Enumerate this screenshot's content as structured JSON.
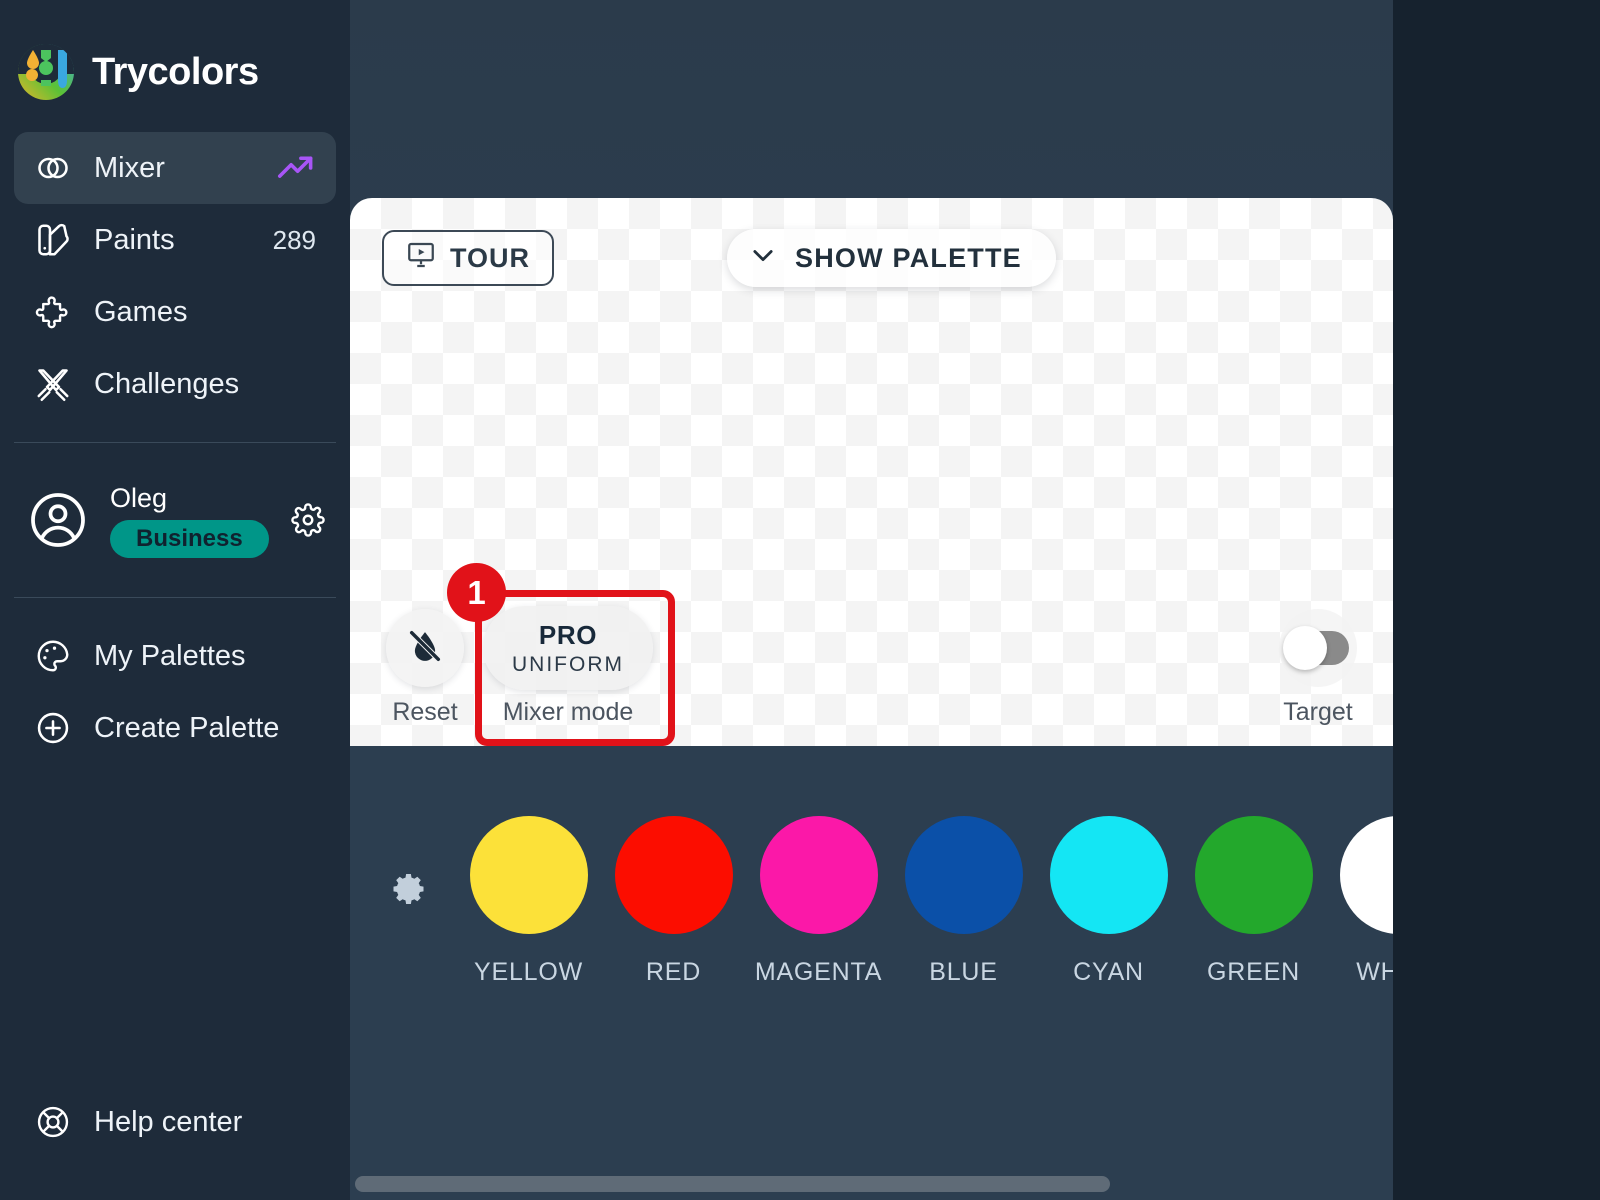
{
  "app": {
    "brand_name": "Trycolors",
    "logo_icon": "trycolors-logo-icon"
  },
  "theme": {
    "sidebar_bg": "#1e2b3a",
    "main_bg": "#2c3e50",
    "outer_bg": "#16222e",
    "accent_teal": "#009688",
    "accent_purple": "#a855f7",
    "annotation_red": "#e11219"
  },
  "sidebar": {
    "items": [
      {
        "label": "Mixer",
        "icon": "mixer-circles-icon",
        "active": true,
        "trend_icon": "trending-up-icon",
        "badge": ""
      },
      {
        "label": "Paints",
        "icon": "paint-swatch-icon",
        "active": false,
        "badge": "289"
      },
      {
        "label": "Games",
        "icon": "puzzle-piece-icon",
        "active": false,
        "badge": ""
      },
      {
        "label": "Challenges",
        "icon": "crossed-swords-icon",
        "active": false,
        "badge": ""
      }
    ],
    "user": {
      "name": "Oleg",
      "plan": "Business",
      "avatar_icon": "user-circle-icon",
      "settings_icon": "gear-icon"
    },
    "palette_items": [
      {
        "label": "My Palettes",
        "icon": "palette-icon"
      },
      {
        "label": "Create Palette",
        "icon": "plus-circle-icon"
      }
    ],
    "help": {
      "label": "Help center",
      "icon": "lifebuoy-icon"
    }
  },
  "canvas": {
    "tour_button": {
      "label": "TOUR",
      "icon": "presentation-play-icon"
    },
    "show_palette_button": {
      "label": "SHOW PALETTE",
      "icon": "chevron-down-icon"
    },
    "controls": {
      "reset": {
        "label": "Reset",
        "icon": "droplet-slash-icon"
      },
      "mixer_mode": {
        "primary": "PRO",
        "secondary": "UNIFORM",
        "label": "Mixer mode"
      },
      "target": {
        "label": "Target",
        "icon": "toggle-switch-icon",
        "state": "off"
      }
    }
  },
  "annotation": {
    "number": "1",
    "target": "mixer-mode-button"
  },
  "palette": {
    "settings_icon": "gear-icon",
    "swatches": [
      {
        "name": "YELLOW",
        "color": "#fce139"
      },
      {
        "name": "RED",
        "color": "#fc0d00"
      },
      {
        "name": "MAGENTA",
        "color": "#fb18a8"
      },
      {
        "name": "BLUE",
        "color": "#0b50a8"
      },
      {
        "name": "CYAN",
        "color": "#14e6f4"
      },
      {
        "name": "GREEN",
        "color": "#23a82c"
      },
      {
        "name": "WHITE",
        "color": "#ffffff"
      }
    ]
  }
}
